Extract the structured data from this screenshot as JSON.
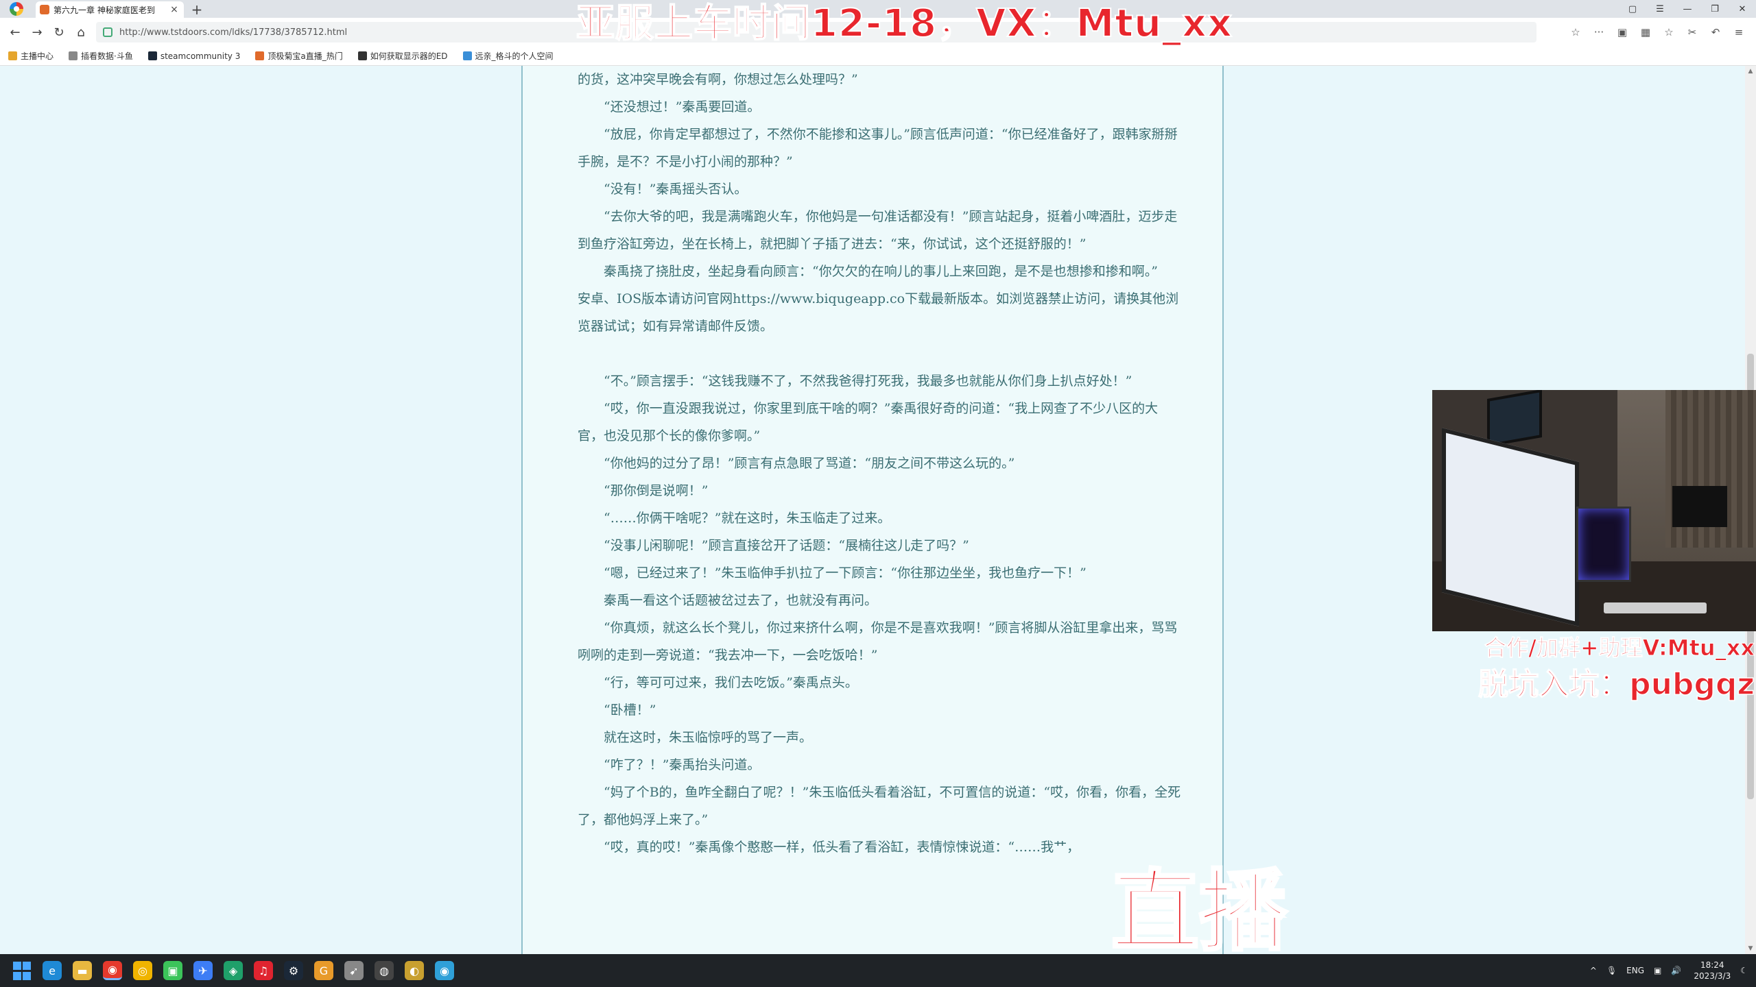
{
  "browser": {
    "tab_title": "第六九一章 神秘家庭医老到",
    "tab_close": "×",
    "new_tab": "+",
    "url": "http://www.tstdoors.com/ldks/17738/3785712.html",
    "window_controls": [
      "▢",
      "☰",
      "—",
      "❐",
      "✕"
    ],
    "toolbar_right": [
      "☆",
      "···",
      "▣",
      "▦",
      "☆",
      "✂",
      "↶",
      "≡"
    ]
  },
  "bookmarks": [
    {
      "label": "主播中心",
      "color": "#e5a52d"
    },
    {
      "label": "插看数据·斗鱼",
      "color": "#888888"
    },
    {
      "label": "steamcommunity 3",
      "color": "#1b2838"
    },
    {
      "label": "顶极菊宝a直播_热门",
      "color": "#e06a2b"
    },
    {
      "label": "如何获取显示器的ED",
      "color": "#333333"
    },
    {
      "label": "远亲_格斗的个人空间",
      "color": "#3a8fd8"
    }
  ],
  "article": {
    "paragraphs": [
      {
        "text": "的货，这冲突早晚会有啊，你想过怎么处理吗？”",
        "indent": false
      },
      {
        "text": "“还没想过！”秦禹要回道。",
        "indent": true
      },
      {
        "text": "“放屁，你肯定早都想过了，不然你不能掺和这事儿。”顾言低声问道：“你已经准备好了，跟韩家掰掰手腕，是不？不是小打小闹的那种？”",
        "indent": true
      },
      {
        "text": "“没有！”秦禹摇头否认。",
        "indent": true
      },
      {
        "text": "“去你大爷的吧，我是满嘴跑火车，你他妈是一句准话都没有！”顾言站起身，挺着小啤酒肚，迈步走到鱼疗浴缸旁边，坐在长椅上，就把脚丫子插了进去：“来，你试试，这个还挺舒服的！”",
        "indent": true
      },
      {
        "text": "秦禹挠了挠肚皮，坐起身看向顾言：“你欠欠的在响儿的事儿上来回跑，是不是也想掺和掺和啊。”",
        "indent": true
      },
      {
        "text": "安卓、IOS版本请访问官网https://www.biqugeapp.co下载最新版本。如浏览器禁止访问，请换其他浏览器试试；如有异常请邮件反馈。",
        "indent": false,
        "notice": true
      },
      {
        "text": "",
        "indent": false,
        "blank": true
      },
      {
        "text": "“不。”顾言摆手：“这钱我赚不了，不然我爸得打死我，我最多也就能从你们身上扒点好处！”",
        "indent": true
      },
      {
        "text": "“哎，你一直没跟我说过，你家里到底干啥的啊？”秦禹很好奇的问道：“我上网查了不少八区的大官，也没见那个长的像你爹啊。”",
        "indent": true
      },
      {
        "text": "“你他妈的过分了昂！”顾言有点急眼了骂道：“朋友之间不带这么玩的。”",
        "indent": true
      },
      {
        "text": "“那你倒是说啊！”",
        "indent": true
      },
      {
        "text": "“……你俩干啥呢？”就在这时，朱玉临走了过来。",
        "indent": true
      },
      {
        "text": "“没事儿闲聊呢！”顾言直接岔开了话题：“展楠往这儿走了吗？”",
        "indent": true
      },
      {
        "text": "“嗯，已经过来了！”朱玉临伸手扒拉了一下顾言：“你往那边坐坐，我也鱼疗一下！”",
        "indent": true
      },
      {
        "text": "秦禹一看这个话题被岔过去了，也就没有再问。",
        "indent": true
      },
      {
        "text": "“你真烦，就这么长个凳儿，你过来挤什么啊，你是不是喜欢我啊！”顾言将脚从浴缸里拿出来，骂骂咧咧的走到一旁说道：“我去冲一下，一会吃饭哈！”",
        "indent": true
      },
      {
        "text": "“行，等可可过来，我们去吃饭。”秦禹点头。",
        "indent": true
      },
      {
        "text": "“卧槽！”",
        "indent": true
      },
      {
        "text": "就在这时，朱玉临惊呼的骂了一声。",
        "indent": true
      },
      {
        "text": "“咋了？！”秦禹抬头问道。",
        "indent": true
      },
      {
        "text": "“妈了个B的，鱼咋全翻白了呢？！”朱玉临低头看着浴缸，不可置信的说道：“哎，你看，你看，全死了，都他妈浮上来了。”",
        "indent": true
      },
      {
        "text": "“哎，真的哎！”秦禹像个憨憨一样，低头看了看浴缸，表情惊悚说道：“……我艹，",
        "indent": true
      }
    ]
  },
  "overlays": {
    "top_banner": "亚服上车时间12-18，VX：Mtu_xx",
    "cam_caption_1": "合作/加群+助理V:Mtu_xx",
    "cam_caption_2": "脱坑入坑：pubgqz",
    "live_badge": "直播"
  },
  "taskbar": {
    "apps": [
      {
        "name": "windows-start",
        "glyph": "",
        "color": "#4aa8ff"
      },
      {
        "name": "edge",
        "glyph": "e",
        "color": "#1f8ad6"
      },
      {
        "name": "file-explorer",
        "glyph": "▬",
        "color": "#e8b840"
      },
      {
        "name": "browser-active",
        "glyph": "◉",
        "color": "#e5392d"
      },
      {
        "name": "chrome",
        "glyph": "◎",
        "color": "#f0b400"
      },
      {
        "name": "wechat",
        "glyph": "▣",
        "color": "#3cc45a"
      },
      {
        "name": "feishu",
        "glyph": "✈",
        "color": "#3d7df5"
      },
      {
        "name": "app-green",
        "glyph": "◈",
        "color": "#1fa06a"
      },
      {
        "name": "netease-music",
        "glyph": "♫",
        "color": "#e0242f"
      },
      {
        "name": "steam",
        "glyph": "⚙",
        "color": "#1b2838"
      },
      {
        "name": "app-g",
        "glyph": "G",
        "color": "#e89a2a"
      },
      {
        "name": "obs-tool",
        "glyph": "➹",
        "color": "#888888"
      },
      {
        "name": "obs",
        "glyph": "◍",
        "color": "#444444"
      },
      {
        "name": "app-owl",
        "glyph": "◐",
        "color": "#c8a030"
      },
      {
        "name": "app-blue",
        "glyph": "◉",
        "color": "#2fa0d8"
      }
    ],
    "tray": {
      "chevron": "^",
      "mic": "🎙",
      "lang": "ENG",
      "network": "▣",
      "volume": "🔊",
      "time": "18:24",
      "date": "2023/3/3",
      "notify": "☾"
    }
  }
}
